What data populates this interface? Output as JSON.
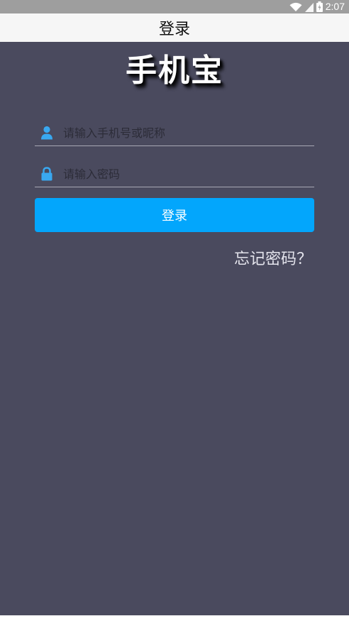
{
  "status_bar": {
    "time": "2:07",
    "icons": [
      "wifi-icon",
      "signal-icon",
      "battery-icon"
    ]
  },
  "app_bar": {
    "title": "登录"
  },
  "logo": {
    "text": "手机宝"
  },
  "form": {
    "username": {
      "icon": "user-icon",
      "placeholder": "请输入手机号或昵称",
      "value": ""
    },
    "password": {
      "icon": "lock-icon",
      "placeholder": "请输入密码",
      "value": ""
    },
    "login_label": "登录",
    "forgot_label": "忘记密码？"
  },
  "colors": {
    "background": "#4a4a5e",
    "accent": "#03a6fc",
    "icon": "#39a8f0",
    "app_bar": "#f6f6f6",
    "status_bar": "#9e9e9e"
  }
}
